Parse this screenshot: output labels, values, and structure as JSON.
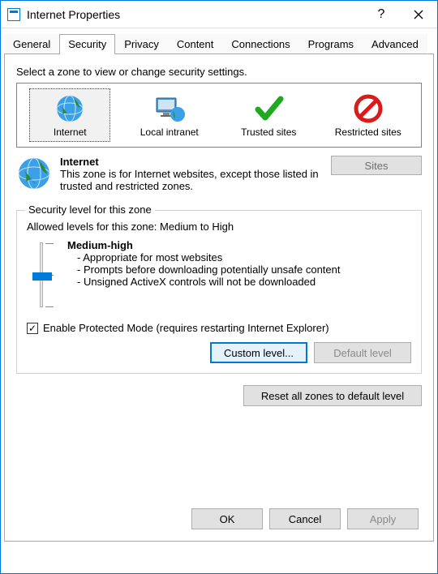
{
  "titlebar": {
    "title": "Internet Properties"
  },
  "tabs": [
    "General",
    "Security",
    "Privacy",
    "Content",
    "Connections",
    "Programs",
    "Advanced"
  ],
  "active_tab_index": 1,
  "panel": {
    "instruction": "Select a zone to view or change security settings.",
    "zones": [
      {
        "label": "Internet",
        "selected": true
      },
      {
        "label": "Local intranet",
        "selected": false
      },
      {
        "label": "Trusted sites",
        "selected": false
      },
      {
        "label": "Restricted sites",
        "selected": false
      }
    ],
    "zone_detail": {
      "title": "Internet",
      "description": "This zone is for Internet websites, except those listed in trusted and restricted zones."
    },
    "sites_button": "Sites",
    "group": {
      "label": "Security level for this zone",
      "allowed": "Allowed levels for this zone: Medium to High",
      "level_name": "Medium-high",
      "line1": "- Appropriate for most websites",
      "line2": "- Prompts before downloading potentially unsafe content",
      "line3": "- Unsigned ActiveX controls will not be downloaded",
      "protected_mode": "Enable Protected Mode (requires restarting Internet Explorer)",
      "protected_mode_checked": true,
      "custom_level": "Custom level...",
      "default_level": "Default level"
    },
    "reset_button": "Reset all zones to default level"
  },
  "dialog": {
    "ok": "OK",
    "cancel": "Cancel",
    "apply": "Apply"
  }
}
